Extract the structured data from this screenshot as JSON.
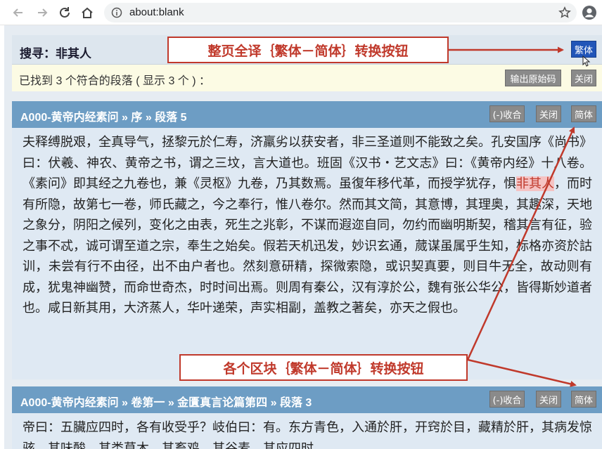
{
  "browser": {
    "url": "about:blank"
  },
  "search": {
    "title": "搜寻：非其人",
    "convert_all_label": "繁体"
  },
  "results": {
    "summary": "已找到 3 个符合的段落 ( 显示 3 个 ) ：",
    "export_label": "输出原始码",
    "close_label": "关闭"
  },
  "blocks": [
    {
      "title": "A000-黄帝内经素问 » 序 » 段落 5",
      "collapse_label": "(-)收合",
      "close_label": "关闭",
      "convert_label": "简体",
      "text_before": "夫释缚脱艰，全真导气，拯黎元於仁寿，济羸劣以获安者，非三圣道则不能致之矣。孔安国序《尚书》曰：伏羲、神农、黄帝之书，谓之三坟，言大道也。班固《汉书・艺文志》曰：《黄帝内经》十八卷。《素问》即其经之九卷也，兼《灵枢》九卷，乃其数焉。虽復年移代革，而授学犹存，惧",
      "highlight": "非其人",
      "text_after": "，而时有所隐，故第七一卷，师氏藏之，今之奉行，惟八卷尔。然而其文简，其意博，其理奥，其趣深，天地之象分，阴阳之候列，变化之由表，死生之兆彰，不谋而遐迩自同，勿约而幽明斯契，稽其言有征，验之事不忒，诚可谓至道之宗，奉生之始矣。假若天机迅发，妙识玄通，蒇谋虽属乎生知，标格亦资於詁训，未尝有行不由径，出不由户者也。然刻意研精，探微索隐，或识契真要，则目牛无全，故动则有成，犹鬼神幽赞，而命世奇杰，时时间出焉。则周有秦公，汉有淳於公，魏有张公华公，皆得斯妙道者也。咸日新其用，大济蒸人，华叶递荣，声实相副，盖教之著矣，亦天之假也。"
    },
    {
      "title": "A000-黄帝内经素问 » 卷第一 » 金匱真言论篇第四 » 段落 3",
      "collapse_label": "(-)收合",
      "close_label": "关闭",
      "convert_label": "简体",
      "text_before": "帝曰：五臟应四时，各有收受乎？岐伯曰：有。东方青色，入通於肝，开窍於目，藏精於肝，其病发惊骇，其味酸，其类草木，其畜鸡，其谷麦，其应四时，",
      "highlight": "",
      "text_after": ""
    }
  ],
  "annotations": {
    "top_callout": "整页全译｛繁体－简体｝转换按钮",
    "bottom_callout": "各个区块｛繁体－简体｝转换按钮"
  },
  "colors": {
    "accent_red": "#c0392b",
    "header_blue": "#6d9dc4",
    "button_blue": "#2155b8",
    "button_gray": "#8a8a8a",
    "highlight_bg": "#f5c3c3"
  }
}
